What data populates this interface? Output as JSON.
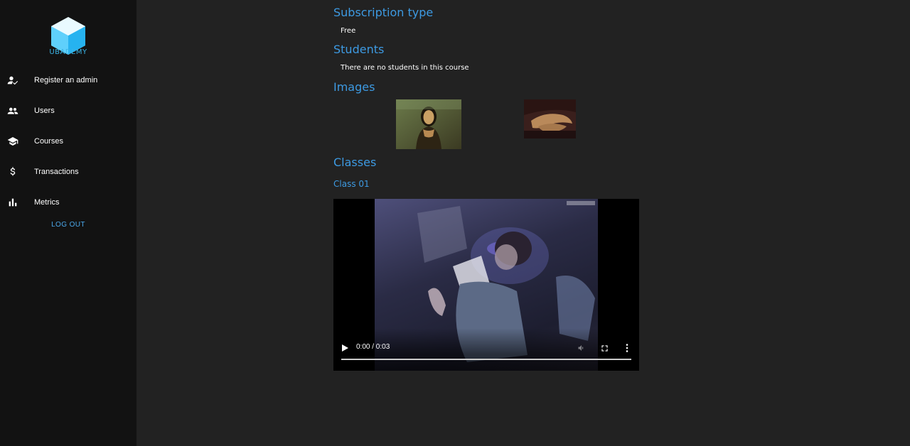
{
  "brand": {
    "name": "UBADEMY",
    "color": "#3ab4e6"
  },
  "sidebar": {
    "items": [
      {
        "label": "Register an admin",
        "icon": "person-check-icon"
      },
      {
        "label": "Users",
        "icon": "people-icon"
      },
      {
        "label": "Courses",
        "icon": "school-icon"
      },
      {
        "label": "Transactions",
        "icon": "dollar-icon"
      },
      {
        "label": "Metrics",
        "icon": "bar-chart-icon"
      }
    ],
    "logout_label": "LOG OUT"
  },
  "main": {
    "subscription": {
      "heading": "Subscription type",
      "value": "Free"
    },
    "students": {
      "heading": "Students",
      "value": "There are no students in this course"
    },
    "images": {
      "heading": "Images",
      "items": [
        "mona-lisa-portrait",
        "mona-lisa-hands-detail"
      ]
    },
    "classes": {
      "heading": "Classes",
      "items": [
        {
          "title": "Class 01"
        }
      ]
    },
    "video": {
      "time": "0:00 / 0:03",
      "progress": 0
    }
  },
  "colors": {
    "accent": "#3d9ae2",
    "sidebar_bg": "#121212",
    "main_bg": "#222222"
  }
}
